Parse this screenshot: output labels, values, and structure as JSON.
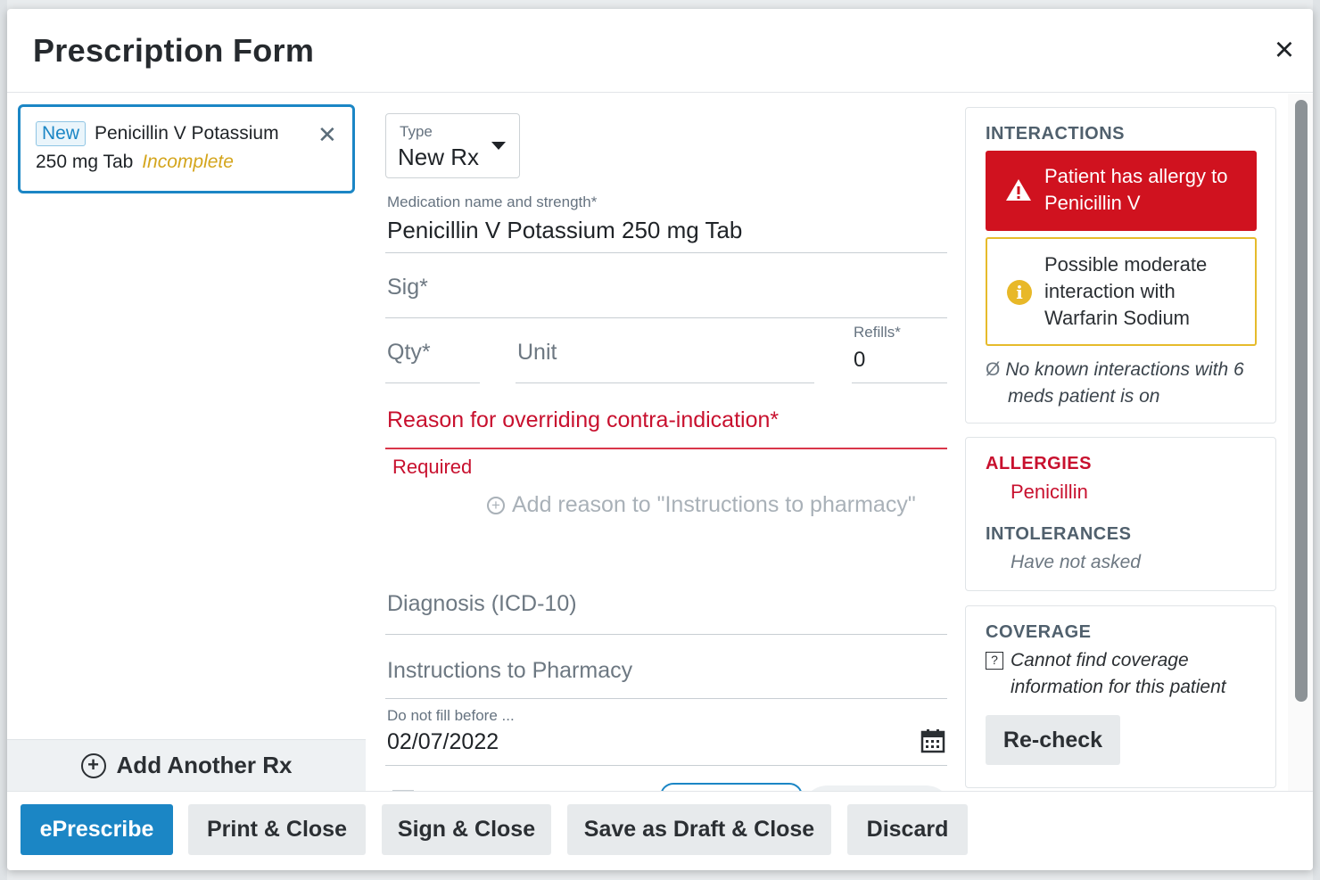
{
  "modal": {
    "title": "Prescription Form"
  },
  "rx_list": {
    "items": [
      {
        "badge": "New",
        "name": "Penicillin V Potassium",
        "detail": "250 mg Tab",
        "status": "Incomplete"
      }
    ],
    "add_label": "Add Another Rx"
  },
  "form": {
    "type": {
      "label": "Type",
      "value": "New Rx"
    },
    "medication": {
      "label": "Medication name and strength*",
      "value": "Penicillin V Potassium 250 mg Tab"
    },
    "sig": {
      "placeholder": "Sig*"
    },
    "qty": {
      "placeholder": "Qty*"
    },
    "unit": {
      "placeholder": "Unit"
    },
    "refills": {
      "label": "Refills*",
      "value": "0"
    },
    "override_reason": {
      "placeholder": "Reason for overriding contra-indication*",
      "error": "Required"
    },
    "add_reason_link": "Add reason to \"Instructions to pharmacy\"",
    "diagnosis": {
      "placeholder": "Diagnosis (ICD-10)"
    },
    "instructions": {
      "placeholder": "Instructions to Pharmacy"
    },
    "do_not_fill": {
      "label": "Do not fill before ...",
      "value": "02/07/2022"
    }
  },
  "interactions": {
    "heading": "INTERACTIONS",
    "allergy_alert": {
      "line1": "Patient has allergy to",
      "line2": "Penicillin V"
    },
    "moderate_alert": {
      "line1": "Possible moderate",
      "line2": "interaction with",
      "line3": "Warfarin Sodium"
    },
    "none_symbol": "Ø",
    "no_known_line1": "No known interactions with 6",
    "no_known_line2": "meds patient is on"
  },
  "allergies": {
    "heading": "ALLERGIES",
    "value": "Penicillin",
    "intolerances_heading": "INTOLERANCES",
    "intolerances_value": "Have not asked"
  },
  "coverage": {
    "heading": "COVERAGE",
    "icon_glyph": "?",
    "line1": "Cannot find coverage",
    "line2": "information for this patient",
    "recheck_label": "Re-check"
  },
  "footer": {
    "eprescribe": "ePrescribe",
    "print_close": "Print & Close",
    "sign_close": "Sign & Close",
    "save_draft": "Save as Draft & Close",
    "discard": "Discard"
  },
  "colors": {
    "primary": "#1b86c5",
    "danger": "#d0121f",
    "warning": "#e6bb2b",
    "incomplete": "#d4a51c"
  },
  "icons": {
    "close": "close-icon",
    "remove_rx": "close-icon",
    "add": "plus-circle-icon",
    "caret": "chevron-down-icon",
    "warning": "warning-triangle-icon",
    "info": "info-icon",
    "calendar": "calendar-icon",
    "coverage": "question-box-icon"
  }
}
